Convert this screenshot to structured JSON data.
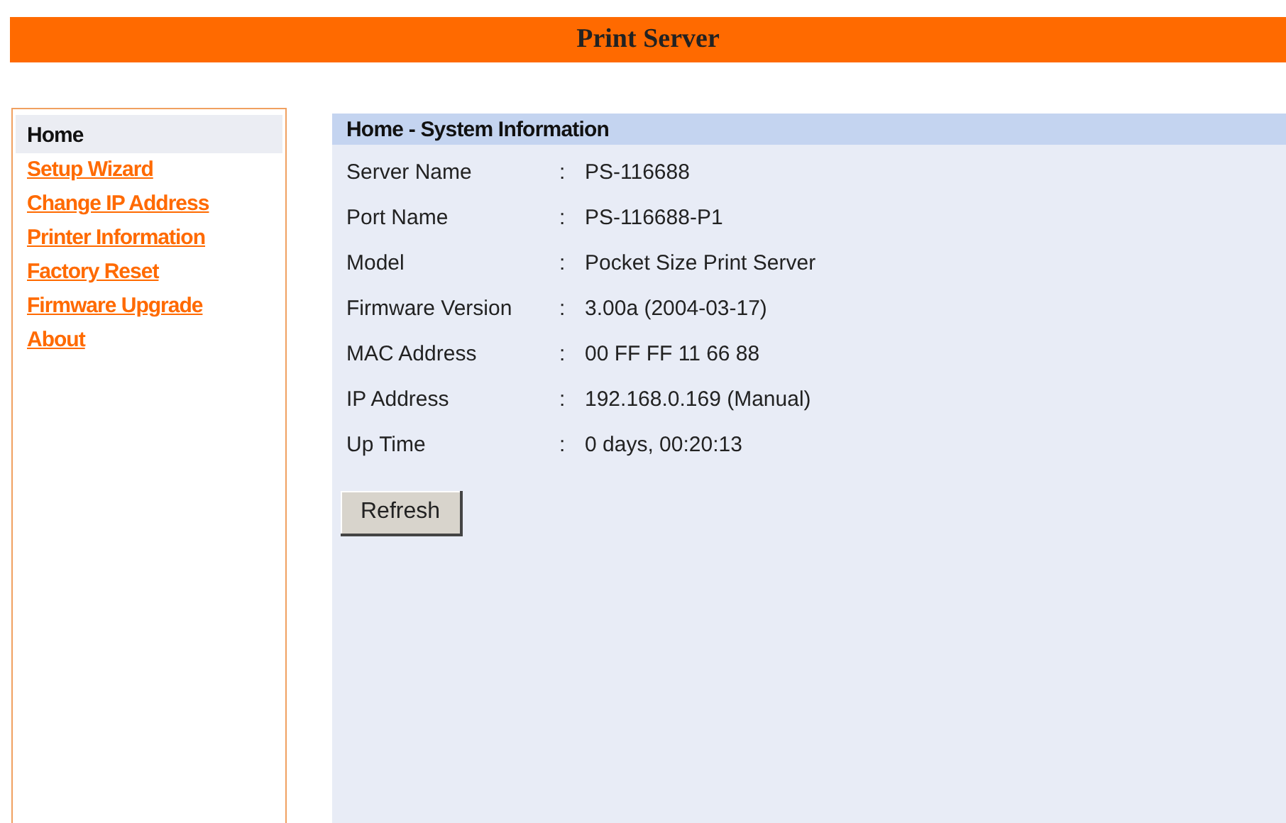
{
  "title": "Print Server",
  "sidebar": {
    "items": [
      {
        "label": "Home",
        "selected": true
      },
      {
        "label": "Setup Wizard",
        "selected": false
      },
      {
        "label": "Change IP Address",
        "selected": false
      },
      {
        "label": "Printer Information",
        "selected": false
      },
      {
        "label": "Factory Reset",
        "selected": false
      },
      {
        "label": "Firmware Upgrade",
        "selected": false
      },
      {
        "label": "About",
        "selected": false
      }
    ]
  },
  "panel": {
    "heading": "Home - System Information",
    "rows": [
      {
        "label": "Server Name",
        "separator": ":",
        "value": "PS-116688"
      },
      {
        "label": "Port Name",
        "separator": ":",
        "value": "PS-116688-P1"
      },
      {
        "label": "Model",
        "separator": ":",
        "value": "Pocket Size Print Server"
      },
      {
        "label": "Firmware Version",
        "separator": ":",
        "value": "3.00a (2004-03-17)"
      },
      {
        "label": "MAC Address",
        "separator": ":",
        "value": "00 FF FF 11 66 88"
      },
      {
        "label": "IP Address",
        "separator": ":",
        "value": "192.168.0.169 (Manual)"
      },
      {
        "label": "Up Time",
        "separator": ":",
        "value": "0 days, 00:20:13"
      }
    ],
    "button": "Refresh"
  }
}
